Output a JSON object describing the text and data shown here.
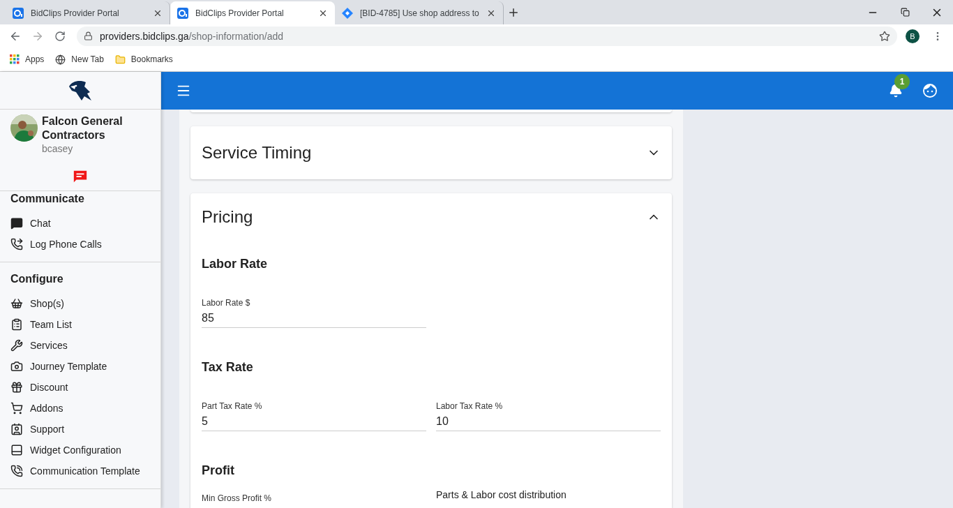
{
  "browser": {
    "tabs": [
      {
        "title": "BidClips Provider Portal",
        "selected": false,
        "kind": "app"
      },
      {
        "title": "BidClips Provider Portal",
        "selected": true,
        "kind": "app"
      },
      {
        "title": "[BID-4785] Use shop address to",
        "selected": false,
        "kind": "jira"
      }
    ],
    "address": {
      "host": "providers.bidclips.ga",
      "path": "/shop-information/add"
    },
    "profile_initial": "B",
    "bookmarks": [
      {
        "label": "Apps",
        "kind": "apps"
      },
      {
        "label": "New Tab",
        "kind": "globe"
      },
      {
        "label": "Bookmarks",
        "kind": "folder"
      }
    ]
  },
  "sidebar": {
    "company": "Falcon General Contractors",
    "username": "bcasey",
    "sections": [
      {
        "title": "Communicate",
        "items": [
          "Chat",
          "Log Phone Calls"
        ]
      },
      {
        "title": "Configure",
        "items": [
          "Shop(s)",
          "Team List",
          "Services",
          "Journey Template",
          "Discount",
          "Addons",
          "Support",
          "Widget Configuration",
          "Communication Template"
        ]
      }
    ]
  },
  "topbar": {
    "notification_count": "1"
  },
  "panels": [
    {
      "title": "Service Timing",
      "expanded": false
    },
    {
      "title": "Pricing",
      "expanded": true,
      "groups": [
        {
          "title": "Labor Rate",
          "fields": [
            {
              "label": "Labor Rate $",
              "value": "85"
            }
          ]
        },
        {
          "title": "Tax Rate",
          "fields": [
            {
              "label": "Part Tax Rate %",
              "value": "5"
            },
            {
              "label": "Labor Tax Rate %",
              "value": "10"
            }
          ]
        },
        {
          "title": "Profit",
          "fields": [
            {
              "label": "Min Gross Profit %",
              "kind": "field"
            },
            {
              "label": "Parts & Labor cost distribution",
              "kind": "heading"
            }
          ]
        }
      ]
    }
  ]
}
